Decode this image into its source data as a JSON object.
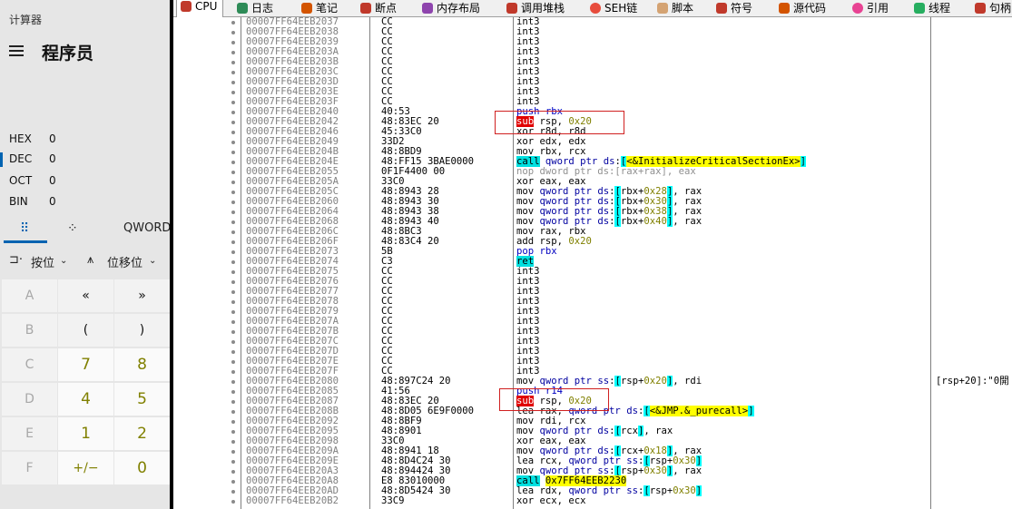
{
  "calculator": {
    "app_title": "计算器",
    "mode_title": "程序员",
    "radix": [
      {
        "label": "HEX",
        "value": "0"
      },
      {
        "label": "DEC",
        "value": "0"
      },
      {
        "label": "OCT",
        "value": "0"
      },
      {
        "label": "BIN",
        "value": "0"
      }
    ],
    "word_size": "QWORD",
    "bitwise_label": "按位",
    "bitshift_label": "位移位",
    "keys": [
      [
        "A",
        "«",
        "»"
      ],
      [
        "B",
        "(",
        ")"
      ],
      [
        "C",
        "7",
        "8"
      ],
      [
        "D",
        "4",
        "5"
      ],
      [
        "E",
        "1",
        "2"
      ],
      [
        "F",
        "+/−",
        "0"
      ]
    ]
  },
  "debugger": {
    "tabs": [
      "CPU",
      "日志",
      "笔记",
      "断点",
      "内存布局",
      "调用堆栈",
      "SEH链",
      "脚本",
      "符号",
      "源代码",
      "引用",
      "线程",
      "句柄"
    ],
    "rows": [
      {
        "addr": "00007FF64EEB2037",
        "bytes": "CC",
        "dis": "int3",
        "cmt": ""
      },
      {
        "addr": "00007FF64EEB2038",
        "bytes": "CC",
        "dis": "int3",
        "cmt": ""
      },
      {
        "addr": "00007FF64EEB2039",
        "bytes": "CC",
        "dis": "int3",
        "cmt": ""
      },
      {
        "addr": "00007FF64EEB203A",
        "bytes": "CC",
        "dis": "int3",
        "cmt": ""
      },
      {
        "addr": "00007FF64EEB203B",
        "bytes": "CC",
        "dis": "int3",
        "cmt": ""
      },
      {
        "addr": "00007FF64EEB203C",
        "bytes": "CC",
        "dis": "int3",
        "cmt": ""
      },
      {
        "addr": "00007FF64EEB203D",
        "bytes": "CC",
        "dis": "int3",
        "cmt": ""
      },
      {
        "addr": "00007FF64EEB203E",
        "bytes": "CC",
        "dis": "int3",
        "cmt": ""
      },
      {
        "addr": "00007FF64EEB203F",
        "bytes": "CC",
        "dis": "int3",
        "cmt": ""
      },
      {
        "addr": "00007FF64EEB2040",
        "bytes": "40:53",
        "dis": "push rbx",
        "cmt": ""
      },
      {
        "addr": "00007FF64EEB2042",
        "bytes": "48:83EC 20",
        "dis": "sub rsp, 0x20",
        "cmt": ""
      },
      {
        "addr": "00007FF64EEB2046",
        "bytes": "45:33C0",
        "dis": "xor r8d, r8d",
        "cmt": ""
      },
      {
        "addr": "00007FF64EEB2049",
        "bytes": "33D2",
        "dis": "xor edx, edx",
        "cmt": ""
      },
      {
        "addr": "00007FF64EEB204B",
        "bytes": "48:8BD9",
        "dis": "mov rbx, rcx",
        "cmt": ""
      },
      {
        "addr": "00007FF64EEB204E",
        "bytes": "48:FF15 3BAE0000",
        "dis": "call qword ptr ds:[<&InitializeCriticalSectionEx>]",
        "cmt": ""
      },
      {
        "addr": "00007FF64EEB2055",
        "bytes": "0F1F4400 00",
        "dis": "nop dword ptr ds:[rax+rax], eax",
        "cmt": ""
      },
      {
        "addr": "00007FF64EEB205A",
        "bytes": "33C0",
        "dis": "xor eax, eax",
        "cmt": ""
      },
      {
        "addr": "00007FF64EEB205C",
        "bytes": "48:8943 28",
        "dis": "mov qword ptr ds:[rbx+0x28], rax",
        "cmt": ""
      },
      {
        "addr": "00007FF64EEB2060",
        "bytes": "48:8943 30",
        "dis": "mov qword ptr ds:[rbx+0x30], rax",
        "cmt": ""
      },
      {
        "addr": "00007FF64EEB2064",
        "bytes": "48:8943 38",
        "dis": "mov qword ptr ds:[rbx+0x38], rax",
        "cmt": ""
      },
      {
        "addr": "00007FF64EEB2068",
        "bytes": "48:8943 40",
        "dis": "mov qword ptr ds:[rbx+0x40], rax",
        "cmt": ""
      },
      {
        "addr": "00007FF64EEB206C",
        "bytes": "48:8BC3",
        "dis": "mov rax, rbx",
        "cmt": ""
      },
      {
        "addr": "00007FF64EEB206F",
        "bytes": "48:83C4 20",
        "dis": "add rsp, 0x20",
        "cmt": ""
      },
      {
        "addr": "00007FF64EEB2073",
        "bytes": "5B",
        "dis": "pop rbx",
        "cmt": ""
      },
      {
        "addr": "00007FF64EEB2074",
        "bytes": "C3",
        "dis": "ret",
        "cmt": ""
      },
      {
        "addr": "00007FF64EEB2075",
        "bytes": "CC",
        "dis": "int3",
        "cmt": ""
      },
      {
        "addr": "00007FF64EEB2076",
        "bytes": "CC",
        "dis": "int3",
        "cmt": ""
      },
      {
        "addr": "00007FF64EEB2077",
        "bytes": "CC",
        "dis": "int3",
        "cmt": ""
      },
      {
        "addr": "00007FF64EEB2078",
        "bytes": "CC",
        "dis": "int3",
        "cmt": ""
      },
      {
        "addr": "00007FF64EEB2079",
        "bytes": "CC",
        "dis": "int3",
        "cmt": ""
      },
      {
        "addr": "00007FF64EEB207A",
        "bytes": "CC",
        "dis": "int3",
        "cmt": ""
      },
      {
        "addr": "00007FF64EEB207B",
        "bytes": "CC",
        "dis": "int3",
        "cmt": ""
      },
      {
        "addr": "00007FF64EEB207C",
        "bytes": "CC",
        "dis": "int3",
        "cmt": ""
      },
      {
        "addr": "00007FF64EEB207D",
        "bytes": "CC",
        "dis": "int3",
        "cmt": ""
      },
      {
        "addr": "00007FF64EEB207E",
        "bytes": "CC",
        "dis": "int3",
        "cmt": ""
      },
      {
        "addr": "00007FF64EEB207F",
        "bytes": "CC",
        "dis": "int3",
        "cmt": ""
      },
      {
        "addr": "00007FF64EEB2080",
        "bytes": "48:897C24 20",
        "dis": "mov qword ptr ss:[rsp+0x20], rdi",
        "cmt": "[rsp+20]:\"0開"
      },
      {
        "addr": "00007FF64EEB2085",
        "bytes": "41:56",
        "dis": "push r14",
        "cmt": ""
      },
      {
        "addr": "00007FF64EEB2087",
        "bytes": "48:83EC 20",
        "dis": "sub rsp, 0x20",
        "cmt": ""
      },
      {
        "addr": "00007FF64EEB208B",
        "bytes": "48:8D05 6E9F0000",
        "dis": "lea rax, qword ptr ds:[<&JMP.&_purecall>]",
        "cmt": ""
      },
      {
        "addr": "00007FF64EEB2092",
        "bytes": "48:8BF9",
        "dis": "mov rdi, rcx",
        "cmt": ""
      },
      {
        "addr": "00007FF64EEB2095",
        "bytes": "48:8901",
        "dis": "mov qword ptr ds:[rcx], rax",
        "cmt": ""
      },
      {
        "addr": "00007FF64EEB2098",
        "bytes": "33C0",
        "dis": "xor eax, eax",
        "cmt": ""
      },
      {
        "addr": "00007FF64EEB209A",
        "bytes": "48:8941 18",
        "dis": "mov qword ptr ds:[rcx+0x18], rax",
        "cmt": ""
      },
      {
        "addr": "00007FF64EEB209E",
        "bytes": "48:8D4C24 30",
        "dis": "lea rcx, qword ptr ss:[rsp+0x30]",
        "cmt": ""
      },
      {
        "addr": "00007FF64EEB20A3",
        "bytes": "48:894424 30",
        "dis": "mov qword ptr ss:[rsp+0x30], rax",
        "cmt": ""
      },
      {
        "addr": "00007FF64EEB20A8",
        "bytes": "E8 83010000",
        "dis": "call 0x7FF64EEB2230",
        "cmt": ""
      },
      {
        "addr": "00007FF64EEB20AD",
        "bytes": "48:8D5424 30",
        "dis": "lea rdx, qword ptr ss:[rsp+0x30]",
        "cmt": ""
      },
      {
        "addr": "00007FF64EEB20B2",
        "bytes": "33C9",
        "dis": "xor ecx, ecx",
        "cmt": ""
      }
    ]
  }
}
